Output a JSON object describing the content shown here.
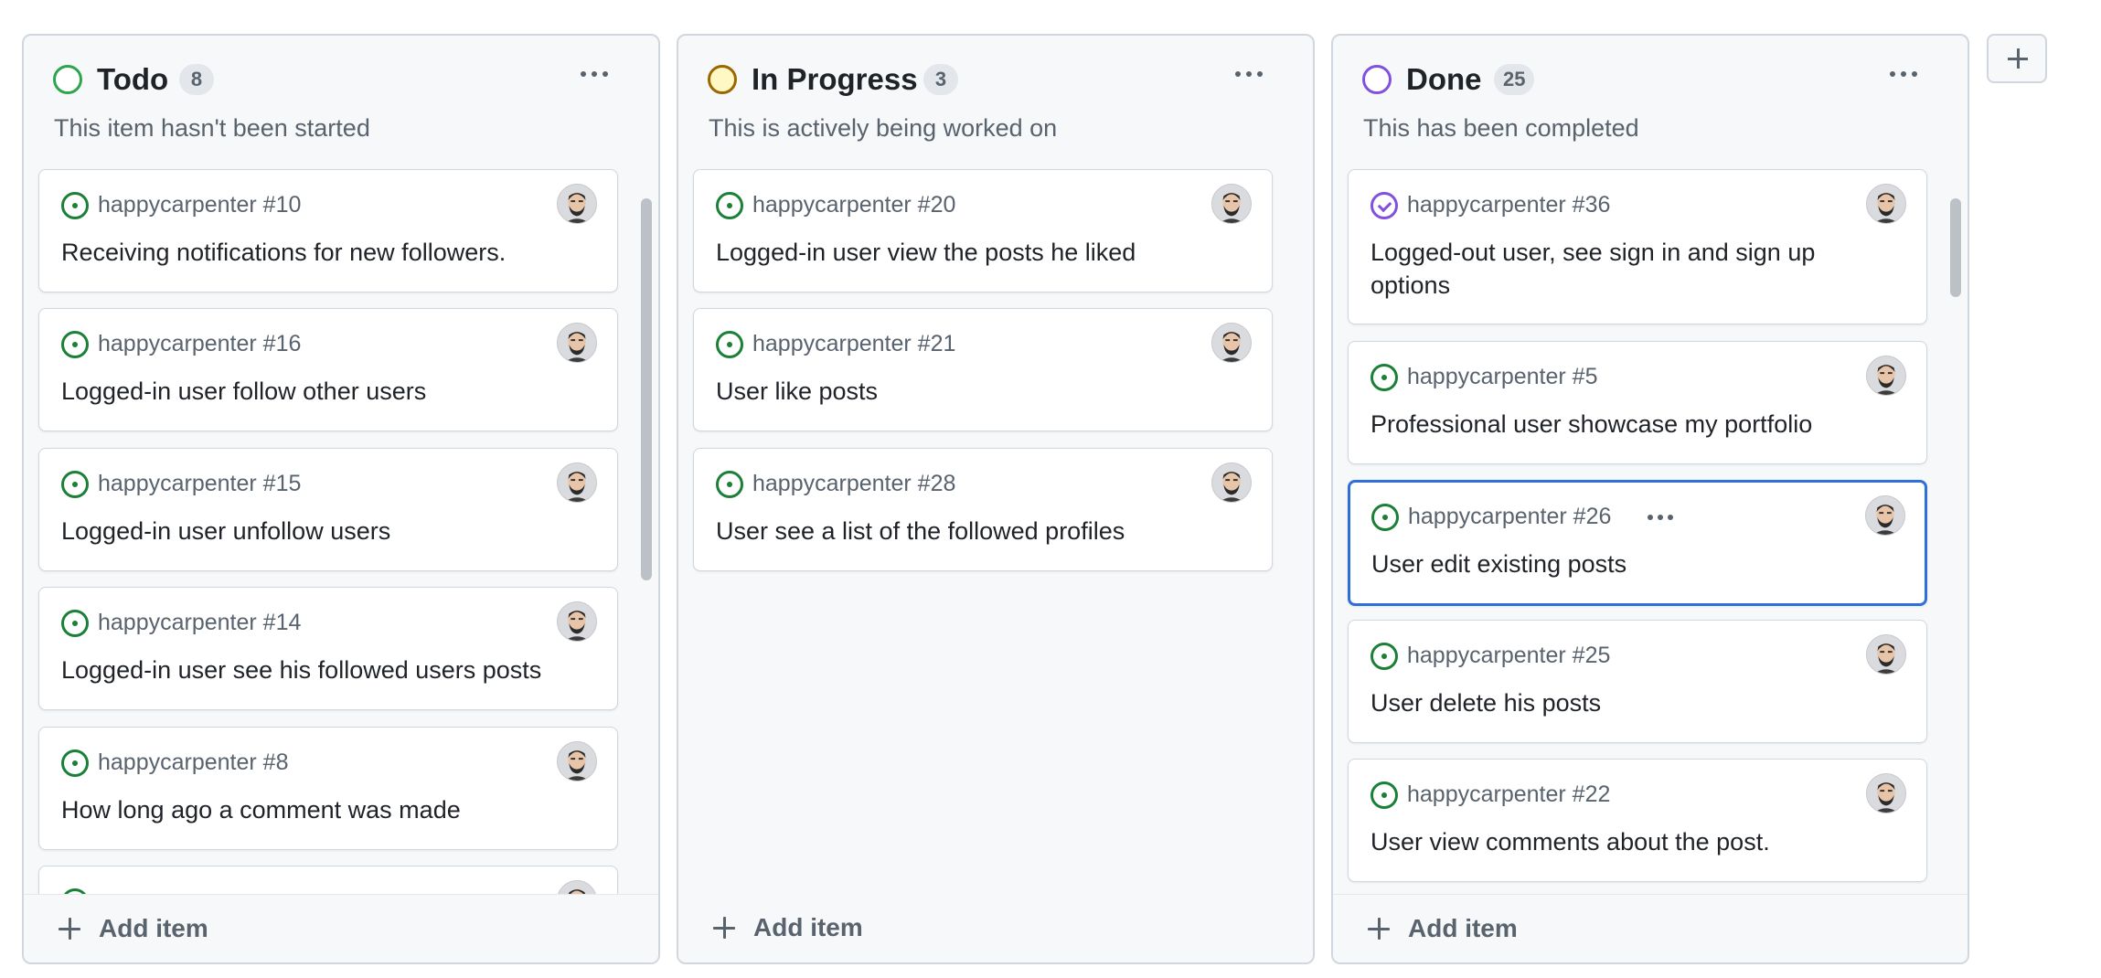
{
  "colors": {
    "todo_status": "#2da44e",
    "in_progress_status": "#9a6700",
    "in_progress_fill": "#fff8c5",
    "done_status": "#8250df",
    "open_issue": "#1a7f37",
    "closed_issue": "#8250df",
    "selected_border": "#2f6fd9"
  },
  "columns": [
    {
      "title": "Todo",
      "count": "8",
      "description": "This item hasn't been started",
      "add_label": "Add item",
      "cards": [
        {
          "ref": "happycarpenter #10",
          "title": "Receiving notifications for new followers.",
          "status": "open"
        },
        {
          "ref": "happycarpenter #16",
          "title": "Logged-in user follow other users",
          "status": "open"
        },
        {
          "ref": "happycarpenter #15",
          "title": "Logged-in user unfollow users",
          "status": "open"
        },
        {
          "ref": "happycarpenter #14",
          "title": "Logged-in user see his followed users posts",
          "status": "open"
        },
        {
          "ref": "happycarpenter #8",
          "title": "How long ago a comment was made",
          "status": "open"
        }
      ]
    },
    {
      "title": "In Progress",
      "count": "3",
      "description": "This is actively being worked on",
      "add_label": "Add item",
      "cards": [
        {
          "ref": "happycarpenter #20",
          "title": "Logged-in user view the posts he liked",
          "status": "open"
        },
        {
          "ref": "happycarpenter #21",
          "title": "User like posts",
          "status": "open"
        },
        {
          "ref": "happycarpenter #28",
          "title": "User see a list of the followed profiles",
          "status": "open"
        }
      ]
    },
    {
      "title": "Done",
      "count": "25",
      "description": "This has been completed",
      "add_label": "Add item",
      "cards": [
        {
          "ref": "happycarpenter #36",
          "title": "Logged-out user, see sign in and sign up options",
          "status": "closed"
        },
        {
          "ref": "happycarpenter #5",
          "title": "Professional user showcase my portfolio",
          "status": "open"
        },
        {
          "ref": "happycarpenter #26",
          "title": "User edit existing posts",
          "status": "open",
          "selected": true
        },
        {
          "ref": "happycarpenter #25",
          "title": "User delete his posts",
          "status": "open"
        },
        {
          "ref": "happycarpenter #22",
          "title": "User view comments about the post.",
          "status": "open"
        }
      ]
    }
  ],
  "icons": {
    "column_menu": "kebab-horizontal-icon",
    "open_issue": "issue-opened-icon",
    "closed_issue": "issue-closed-icon",
    "add": "plus-icon",
    "avatar": "user-avatar"
  }
}
